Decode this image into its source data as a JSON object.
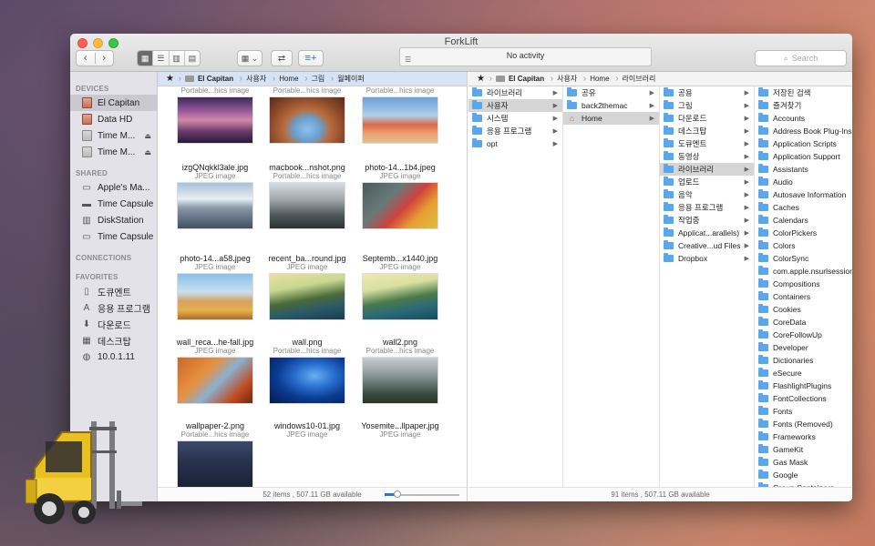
{
  "window": {
    "title": "ForkLift"
  },
  "toolbar": {
    "back": "‹",
    "forward": "›",
    "activity": "No activity",
    "search_placeholder": "Search"
  },
  "sidebar": {
    "devices_header": "DEVICES",
    "devices": [
      "El Capitan",
      "Data HD",
      "Time M...",
      "Time M..."
    ],
    "shared_header": "SHARED",
    "shared": [
      "Apple's Ma...",
      "Time Capsule",
      "DiskStation",
      "Time Capsule"
    ],
    "connections_header": "CONNECTIONS",
    "favorites_header": "FAVORITES",
    "favorites": [
      "도큐멘트",
      "응용 프로그램",
      "다운로드",
      "데스크탑",
      "10.0.1.11"
    ]
  },
  "left_pane": {
    "path": [
      "★",
      "El Capitan",
      "사용자",
      "Home",
      "그림",
      "월페이퍼"
    ],
    "top_kinds": [
      "Portable...hics image",
      "Portable...hics image",
      "Portable...hics image"
    ],
    "files": [
      {
        "name": "izgQNqkkl3ale.jpg",
        "kind": "JPEG image"
      },
      {
        "name": "macbook...nshot.png",
        "kind": "Portable...hics image"
      },
      {
        "name": "photo-14...1b4.jpeg",
        "kind": "JPEG image"
      },
      {
        "name": "photo-14...a58.jpeg",
        "kind": "JPEG image"
      },
      {
        "name": "recent_ba...round.jpg",
        "kind": "JPEG image"
      },
      {
        "name": "Septemb...x1440.jpg",
        "kind": "JPEG image"
      },
      {
        "name": "wall_reca...he-fall.jpg",
        "kind": "JPEG image"
      },
      {
        "name": "wall.png",
        "kind": "Portable...hics image"
      },
      {
        "name": "wall2.png",
        "kind": "Portable...hics image"
      },
      {
        "name": "wallpaper-2.png",
        "kind": "Portable...hics image"
      },
      {
        "name": "windows10-01.jpg",
        "kind": "JPEG image"
      },
      {
        "name": "Yosemite...llpaper.jpg",
        "kind": "JPEG image"
      }
    ],
    "status": "52 items , 507.11 GB available"
  },
  "right_pane": {
    "path": [
      "★",
      "El Capitan",
      "사용자",
      "Home",
      "라이브러리"
    ],
    "col1": [
      "라이브러리",
      "사용자",
      "시스템",
      "응용 프로그램",
      "opt"
    ],
    "col2": [
      "공유",
      "back2themac",
      "Home"
    ],
    "col3": [
      "공용",
      "그림",
      "다운로드",
      "데스크탑",
      "도큐멘트",
      "동영상",
      "라이브러리",
      "업로드",
      "음악",
      "응용 프로그램",
      "작업중",
      "Applicat...arallels)",
      "Creative...ud Files",
      "Dropbox"
    ],
    "col4": [
      "저장된 검색",
      "즐겨찾기",
      "Accounts",
      "Address Book Plug-Ins",
      "Application Scripts",
      "Application Support",
      "Assistants",
      "Audio",
      "Autosave Information",
      "Caches",
      "Calendars",
      "ColorPickers",
      "Colors",
      "ColorSync",
      "com.apple.nsurlsessiond",
      "Compositions",
      "Containers",
      "Cookies",
      "CoreData",
      "CoreFollowUp",
      "Developer",
      "Dictionaries",
      "eSecure",
      "FlashlightPlugins",
      "FontCollections",
      "Fonts",
      "Fonts (Removed)",
      "Frameworks",
      "GameKit",
      "Gas Mask",
      "Google",
      "Group Containers"
    ],
    "status": "91 items , 507.11 GB available"
  }
}
